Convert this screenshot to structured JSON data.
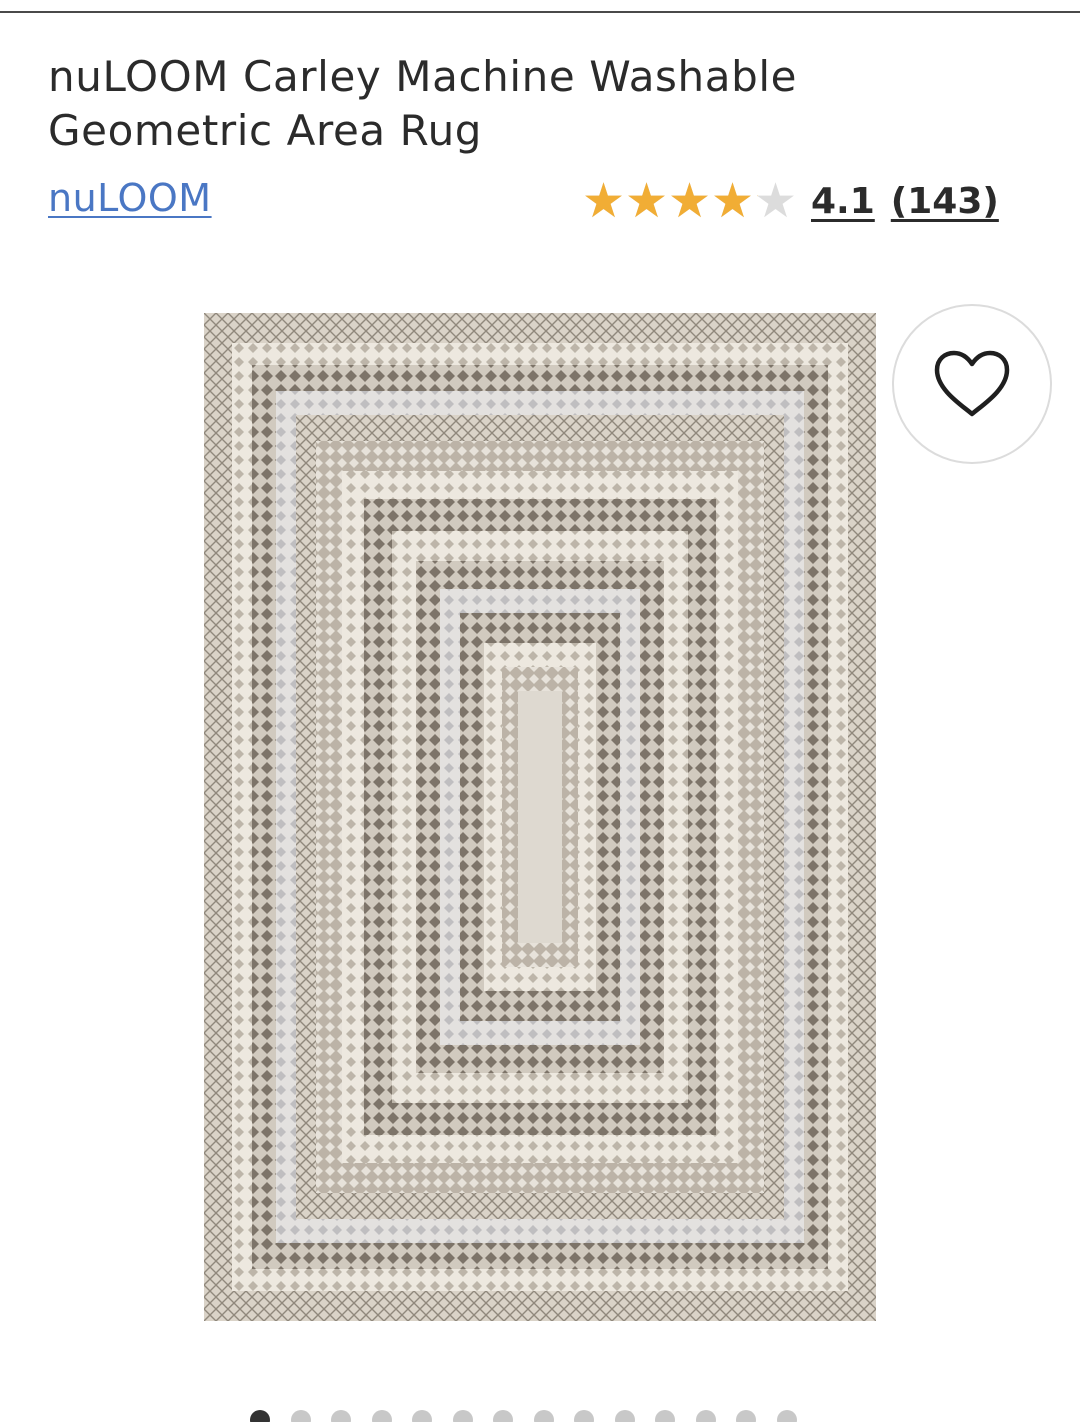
{
  "product": {
    "title": "nuLOOM Carley Machine Washable Geometric Area Rug",
    "brand": "nuLOOM",
    "rating": 4.1,
    "rating_text": "4.1",
    "review_count_text": "(143)"
  },
  "icons": {
    "wishlist": "heart-outline-icon",
    "star": "star-icon"
  },
  "gallery": {
    "image_count": 14,
    "active_index": 0
  },
  "colors": {
    "star_filled": "#f1ad35",
    "star_empty": "#dcdcdc",
    "link": "#4a77c4",
    "rug_base": "#d9d3ca",
    "rug_dark": "#7d7468",
    "rug_light": "#efebe3"
  }
}
